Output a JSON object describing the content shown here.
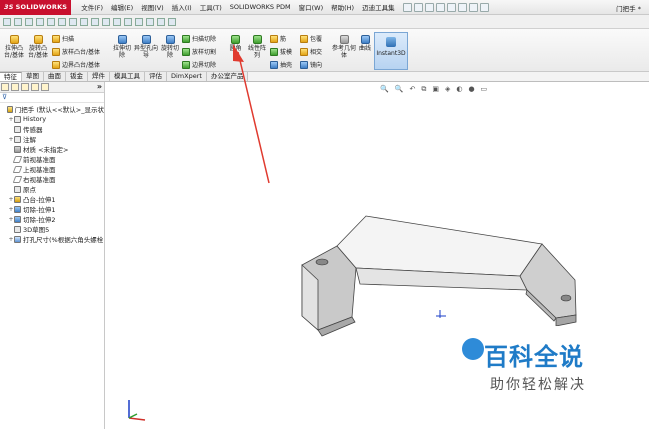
{
  "app": {
    "brand": "SOLIDWORKS",
    "doc_title": "门把手 *"
  },
  "menu": [
    "文件(F)",
    "编辑(E)",
    "视图(V)",
    "插入(I)",
    "工具(T)",
    "SOLIDWORKS PDM",
    "窗口(W)",
    "帮助(H)",
    "迈迪工具集"
  ],
  "ribbon": {
    "extrude_boss": "拉伸凸台/基体",
    "revolve_boss": "旋转凸台/基体",
    "sweep": "扫描",
    "loft_boss": "放样凸台/基体",
    "boundary_boss": "边界凸台/基体",
    "extrude_cut": "拉伸切除",
    "hole_wizard": "异型孔向导",
    "revolve_cut": "旋转切除",
    "sweep_cut": "扫描切除",
    "loft_cut": "放样切割",
    "boundary_cut": "边界切除",
    "fillet": "圆角",
    "linear_pattern": "线性阵列",
    "rib": "筋",
    "draft": "拔模",
    "shell": "抽壳",
    "wrap": "包覆",
    "intersect": "相交",
    "mirror": "镜向",
    "ref_geometry": "参考几何体",
    "curves": "曲线",
    "instant3d": "Instant3D"
  },
  "tabs": [
    "特征",
    "草图",
    "曲面",
    "钣金",
    "焊件",
    "模具工具",
    "评估",
    "DimXpert",
    "办公室产品"
  ],
  "tree": [
    {
      "label": "门把手 (默认<<默认>_显示状",
      "icon": "part",
      "level": 1,
      "expand": ""
    },
    {
      "label": "History",
      "icon": "misc",
      "level": 2,
      "expand": "+"
    },
    {
      "label": "传感器",
      "icon": "misc",
      "level": 2,
      "expand": ""
    },
    {
      "label": "注解",
      "icon": "misc",
      "level": 2,
      "expand": "+"
    },
    {
      "label": "材质 <未指定>",
      "icon": "mat",
      "level": 2,
      "expand": ""
    },
    {
      "label": "前视基准面",
      "icon": "plane",
      "level": 2,
      "expand": ""
    },
    {
      "label": "上视基准面",
      "icon": "plane",
      "level": 2,
      "expand": ""
    },
    {
      "label": "右视基准面",
      "icon": "plane",
      "level": 2,
      "expand": ""
    },
    {
      "label": "原点",
      "icon": "misc",
      "level": 2,
      "expand": ""
    },
    {
      "label": "凸台-拉伸1",
      "icon": "feat",
      "level": 2,
      "expand": "+"
    },
    {
      "label": "切除-拉伸1",
      "icon": "cut",
      "level": 2,
      "expand": "+"
    },
    {
      "label": "切除-拉伸2",
      "icon": "cut",
      "level": 2,
      "expand": "+"
    },
    {
      "label": "3D草图5",
      "icon": "misc",
      "level": 2,
      "expand": ""
    },
    {
      "label": "打孔尺寸(%根据六角头螺栓",
      "icon": "hole",
      "level": 2,
      "expand": "+"
    }
  ],
  "watermark": {
    "main": "百科全说",
    "sub": "助你轻松解决"
  },
  "colors": {
    "brand_red": "#c8102e",
    "annotation_arrow": "#e03a2f",
    "watermark_blue": "#1f7bc7"
  }
}
